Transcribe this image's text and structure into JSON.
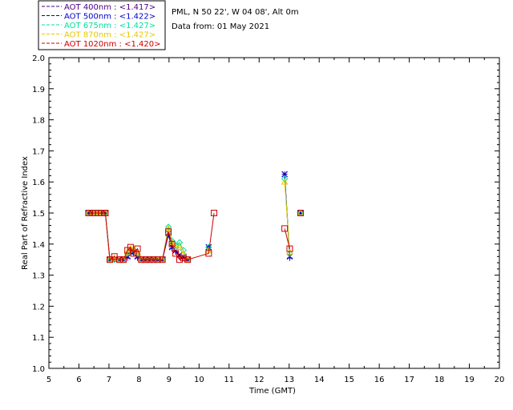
{
  "info": {
    "site": "PML, N 50 22', W 04 08', Alt 0m",
    "date": "Data from: 01 May 2021"
  },
  "chart_data": {
    "type": "line",
    "title": "",
    "xlabel": "Time (GMT)",
    "ylabel": "Real Part of Refractive Index",
    "xlim": [
      5,
      20
    ],
    "ylim": [
      1.0,
      2.0
    ],
    "xticks": [
      "5",
      "6",
      "7",
      "8",
      "9",
      "10",
      "11",
      "12",
      "13",
      "14",
      "15",
      "16",
      "17",
      "18",
      "19",
      "20"
    ],
    "yticks": [
      "1.0",
      "1.1",
      "1.2",
      "1.3",
      "1.4",
      "1.5",
      "1.6",
      "1.7",
      "1.8",
      "1.9",
      "2.0"
    ],
    "grid": false,
    "legend_position": "top-left, outside plot",
    "series": [
      {
        "name": "AOT  400nm : <1.417>",
        "color": "#4b0082",
        "marker": "plus",
        "segments": [
          [
            [
              6.32,
              1.5
            ],
            [
              6.45,
              1.5
            ],
            [
              6.55,
              1.5
            ],
            [
              6.65,
              1.5
            ],
            [
              6.75,
              1.5
            ],
            [
              6.88,
              1.5
            ],
            [
              7.03,
              1.35
            ],
            [
              7.18,
              1.35
            ],
            [
              7.35,
              1.35
            ],
            [
              7.48,
              1.35
            ],
            [
              7.62,
              1.355
            ],
            [
              7.72,
              1.37
            ],
            [
              7.82,
              1.37
            ],
            [
              7.95,
              1.355
            ],
            [
              8.08,
              1.35
            ],
            [
              8.22,
              1.35
            ],
            [
              8.35,
              1.35
            ],
            [
              8.48,
              1.35
            ],
            [
              8.62,
              1.35
            ],
            [
              8.78,
              1.35
            ],
            [
              8.98,
              1.43
            ],
            [
              9.1,
              1.385
            ],
            [
              9.22,
              1.375
            ],
            [
              9.35,
              1.36
            ],
            [
              9.48,
              1.355
            ],
            [
              9.62,
              1.35
            ]
          ],
          [
            [
              10.32,
              1.39
            ]
          ],
          [
            [
              12.85,
              1.625
            ],
            [
              13.02,
              1.355
            ]
          ],
          [
            [
              13.38,
              1.5
            ]
          ]
        ]
      },
      {
        "name": "AOT  500nm : <1.422>",
        "color": "#0000cd",
        "marker": "cross",
        "segments": [
          [
            [
              6.32,
              1.5
            ],
            [
              6.45,
              1.5
            ],
            [
              6.55,
              1.5
            ],
            [
              6.65,
              1.5
            ],
            [
              6.75,
              1.5
            ],
            [
              6.88,
              1.5
            ],
            [
              7.03,
              1.35
            ],
            [
              7.18,
              1.35
            ],
            [
              7.35,
              1.35
            ],
            [
              7.48,
              1.35
            ],
            [
              7.62,
              1.36
            ],
            [
              7.72,
              1.375
            ],
            [
              7.82,
              1.375
            ],
            [
              7.95,
              1.36
            ],
            [
              8.08,
              1.35
            ],
            [
              8.22,
              1.35
            ],
            [
              8.35,
              1.35
            ],
            [
              8.48,
              1.35
            ],
            [
              8.62,
              1.35
            ],
            [
              8.78,
              1.35
            ],
            [
              8.98,
              1.435
            ],
            [
              9.1,
              1.39
            ],
            [
              9.22,
              1.38
            ],
            [
              9.35,
              1.365
            ],
            [
              9.48,
              1.36
            ],
            [
              9.62,
              1.35
            ]
          ],
          [
            [
              10.32,
              1.39
            ]
          ],
          [
            [
              12.85,
              1.625
            ],
            [
              13.02,
              1.36
            ]
          ],
          [
            [
              13.38,
              1.5
            ]
          ]
        ]
      },
      {
        "name": "AOT  675nm : <1.427>",
        "color": "#00e0a0",
        "marker": "diamond",
        "segments": [
          [
            [
              6.32,
              1.5
            ],
            [
              6.45,
              1.5
            ],
            [
              6.55,
              1.5
            ],
            [
              6.65,
              1.5
            ],
            [
              6.75,
              1.5
            ],
            [
              6.88,
              1.5
            ],
            [
              7.03,
              1.35
            ],
            [
              7.18,
              1.35
            ],
            [
              7.35,
              1.35
            ],
            [
              7.48,
              1.35
            ],
            [
              7.62,
              1.37
            ],
            [
              7.72,
              1.38
            ],
            [
              7.82,
              1.38
            ],
            [
              7.95,
              1.37
            ],
            [
              8.08,
              1.35
            ],
            [
              8.22,
              1.35
            ],
            [
              8.35,
              1.35
            ],
            [
              8.48,
              1.35
            ],
            [
              8.62,
              1.35
            ],
            [
              8.78,
              1.35
            ],
            [
              8.98,
              1.455
            ],
            [
              9.1,
              1.41
            ],
            [
              9.22,
              1.395
            ],
            [
              9.35,
              1.405
            ],
            [
              9.48,
              1.38
            ],
            [
              9.62,
              1.35
            ]
          ],
          [
            [
              10.32,
              1.39
            ]
          ],
          [
            [
              12.85,
              1.61
            ],
            [
              13.02,
              1.37
            ]
          ],
          [
            [
              13.38,
              1.5
            ]
          ]
        ]
      },
      {
        "name": "AOT  870nm : <1.427>",
        "color": "#e6c800",
        "marker": "triangle",
        "segments": [
          [
            [
              6.32,
              1.5
            ],
            [
              6.45,
              1.5
            ],
            [
              6.55,
              1.5
            ],
            [
              6.65,
              1.5
            ],
            [
              6.75,
              1.5
            ],
            [
              6.88,
              1.5
            ],
            [
              7.03,
              1.35
            ],
            [
              7.18,
              1.355
            ],
            [
              7.35,
              1.35
            ],
            [
              7.48,
              1.35
            ],
            [
              7.62,
              1.375
            ],
            [
              7.72,
              1.385
            ],
            [
              7.82,
              1.385
            ],
            [
              7.95,
              1.375
            ],
            [
              8.08,
              1.35
            ],
            [
              8.22,
              1.35
            ],
            [
              8.35,
              1.35
            ],
            [
              8.48,
              1.35
            ],
            [
              8.62,
              1.35
            ],
            [
              8.78,
              1.35
            ],
            [
              8.98,
              1.45
            ],
            [
              9.1,
              1.405
            ],
            [
              9.22,
              1.39
            ],
            [
              9.35,
              1.39
            ],
            [
              9.48,
              1.37
            ],
            [
              9.62,
              1.35
            ]
          ],
          [
            [
              10.32,
              1.38
            ]
          ],
          [
            [
              12.85,
              1.6
            ],
            [
              13.02,
              1.375
            ]
          ],
          [
            [
              13.38,
              1.5
            ]
          ]
        ]
      },
      {
        "name": "AOT 1020nm : <1.420>",
        "color": "#cc0000",
        "marker": "square",
        "segments": [
          [
            [
              6.32,
              1.5
            ],
            [
              6.45,
              1.5
            ],
            [
              6.55,
              1.5
            ],
            [
              6.65,
              1.5
            ],
            [
              6.75,
              1.5
            ],
            [
              6.88,
              1.5
            ],
            [
              7.03,
              1.35
            ],
            [
              7.18,
              1.36
            ],
            [
              7.35,
              1.35
            ],
            [
              7.48,
              1.35
            ],
            [
              7.62,
              1.38
            ],
            [
              7.72,
              1.39
            ],
            [
              7.82,
              1.37
            ],
            [
              7.95,
              1.385
            ],
            [
              8.08,
              1.35
            ],
            [
              8.22,
              1.35
            ],
            [
              8.35,
              1.35
            ],
            [
              8.48,
              1.35
            ],
            [
              8.62,
              1.35
            ],
            [
              8.78,
              1.35
            ],
            [
              8.98,
              1.44
            ],
            [
              9.1,
              1.4
            ],
            [
              9.22,
              1.37
            ],
            [
              9.35,
              1.35
            ],
            [
              9.48,
              1.355
            ],
            [
              9.62,
              1.35
            ],
            [
              10.32,
              1.37
            ],
            [
              10.5,
              1.5
            ]
          ],
          [
            [
              12.85,
              1.45
            ],
            [
              13.02,
              1.385
            ]
          ],
          [
            [
              13.38,
              1.5
            ]
          ]
        ]
      }
    ]
  }
}
